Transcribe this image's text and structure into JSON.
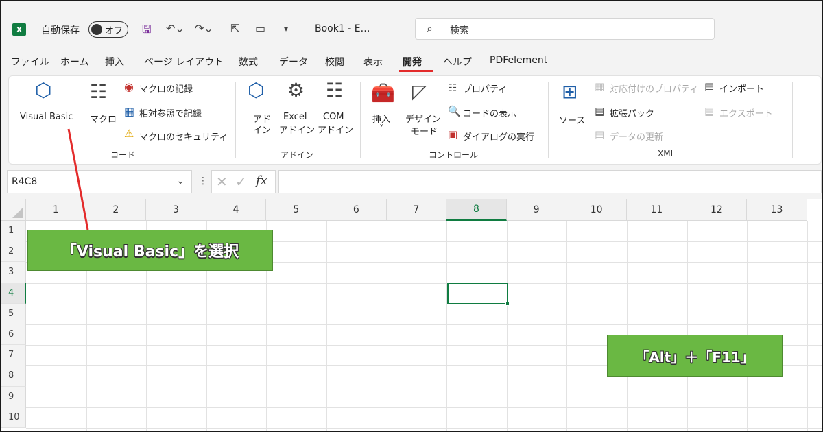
{
  "app": {
    "logo_letter": "X",
    "autosave_label": "自動保存",
    "autosave_state": "オフ",
    "doc_title": "Book1 - E…",
    "search_label": "検索"
  },
  "tabs": [
    {
      "label": "ファイル"
    },
    {
      "label": "ホーム"
    },
    {
      "label": "挿入"
    },
    {
      "label": "ページ レイアウト"
    },
    {
      "label": "数式"
    },
    {
      "label": "データ"
    },
    {
      "label": "校閲"
    },
    {
      "label": "表示"
    },
    {
      "label": "開発",
      "active": true
    },
    {
      "label": "ヘルプ"
    },
    {
      "label": "PDFelement"
    }
  ],
  "ribbon": {
    "code": {
      "group_label": "コード",
      "visual_basic": "Visual Basic",
      "macro": "マクロ",
      "record_macro": "マクロの記録",
      "relative_ref": "相対参照で記録",
      "macro_security": "マクロのセキュリティ"
    },
    "addins": {
      "group_label": "アドイン",
      "addin_line1": "アド",
      "addin_line2": "イン",
      "excel_line1": "Excel",
      "excel_line2": "アドイン",
      "com_line1": "COM",
      "com_line2": "アドイン"
    },
    "controls": {
      "group_label": "コントロール",
      "insert": "挿入",
      "insert_arrow": "˅",
      "design_line1": "デザイン",
      "design_line2": "モード",
      "properties": "プロパティ",
      "view_code": "コードの表示",
      "run_dialog": "ダイアログの実行"
    },
    "xml": {
      "group_label": "XML",
      "source": "ソース",
      "map_properties": "対応付けのプロパティ",
      "expansion_packs": "拡張パック",
      "refresh_data": "データの更新",
      "import": "インポート",
      "export": "エクスポート"
    }
  },
  "formula_bar": {
    "name_box": "R4C8",
    "fx": "fx"
  },
  "grid": {
    "columns": [
      "1",
      "2",
      "3",
      "4",
      "5",
      "6",
      "7",
      "8",
      "9",
      "10",
      "11",
      "12",
      "13"
    ],
    "rows": [
      "1",
      "2",
      "3",
      "4",
      "5",
      "6",
      "7",
      "8",
      "9",
      "10"
    ],
    "selected_column": "8",
    "selected_row": "4"
  },
  "annotations": {
    "visual_basic_callout": "「Visual Basic」を選択",
    "shortcut_callout": "「Alt」＋「F11」",
    "accent_color": "#6ab843",
    "line_color": "#e32b2b"
  },
  "colors": {
    "excel_green": "#107c41",
    "tab_underline": "#e32b2b"
  }
}
